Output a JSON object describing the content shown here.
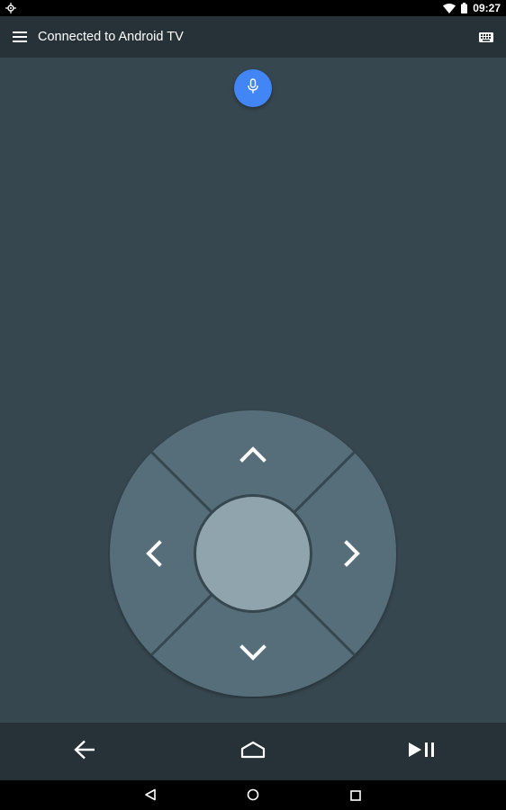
{
  "status_bar": {
    "time": "09:27",
    "icons": [
      "location-icon",
      "wifi-icon",
      "battery-icon"
    ]
  },
  "app_bar": {
    "title": "Connected to Android TV",
    "menu_icon": "hamburger-menu-icon",
    "keyboard_icon": "keyboard-icon"
  },
  "voice": {
    "icon": "microphone-icon",
    "color": "#4285f4"
  },
  "dpad": {
    "ring_color": "#546e7a",
    "center_color": "#90a4ae",
    "icons": [
      "chevron-up-icon",
      "chevron-down-icon",
      "chevron-left-icon",
      "chevron-right-icon"
    ]
  },
  "controls": {
    "icons": [
      "back-arrow-icon",
      "home-icon",
      "play-pause-icon"
    ]
  },
  "system_nav": {
    "icons": [
      "nav-back-icon",
      "nav-home-icon",
      "nav-recents-icon"
    ]
  },
  "colors": {
    "background": "#37474f",
    "app_bar": "#263238",
    "status_bar": "#000000"
  }
}
